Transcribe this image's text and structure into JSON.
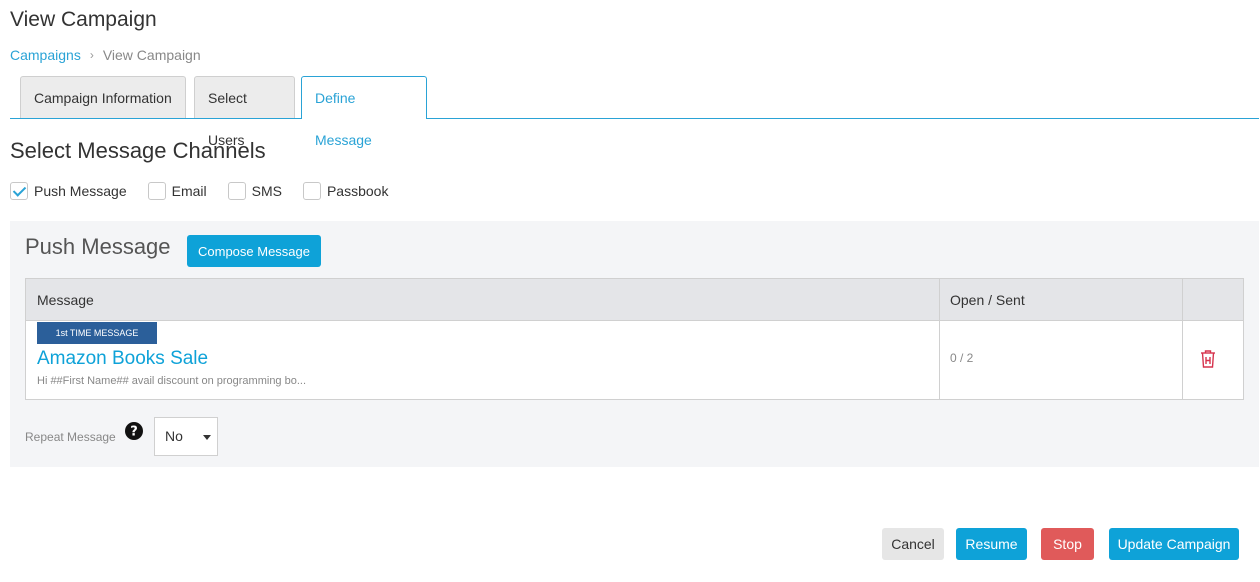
{
  "page": {
    "title": "View Campaign",
    "breadcrumb": [
      "Campaigns",
      "View Campaign"
    ]
  },
  "tabs": [
    {
      "label": "Campaign Information",
      "active": false
    },
    {
      "label": "Select Users",
      "active": false
    },
    {
      "label": "Define Message",
      "active": true
    }
  ],
  "channels": {
    "heading": "Select Message Channels",
    "items": [
      {
        "label": "Push Message",
        "checked": true
      },
      {
        "label": "Email",
        "checked": false
      },
      {
        "label": "SMS",
        "checked": false
      },
      {
        "label": "Passbook",
        "checked": false
      }
    ]
  },
  "push_panel": {
    "title": "Push Message",
    "compose_label": "Compose Message",
    "table": {
      "headers": [
        "Message",
        "Open / Sent"
      ],
      "rows": [
        {
          "badge": "1st TIME MESSAGE",
          "title": "Amazon Books Sale",
          "preview": "Hi ##First Name## avail discount on programming bo...",
          "open_sent": "0 / 2"
        }
      ]
    },
    "repeat": {
      "label": "Repeat Message",
      "value": "No"
    }
  },
  "actions": {
    "cancel": "Cancel",
    "resume": "Resume",
    "stop": "Stop",
    "update": "Update Campaign"
  },
  "colors": {
    "accent": "#0ea2d8",
    "badge": "#2b5f9a",
    "danger": "#e05a5a",
    "delete_icon": "#d6334d"
  },
  "icons": {
    "breadcrumb_separator": "chevron-right-icon",
    "help": "question-circle-icon",
    "delete": "trash-icon",
    "dropdown": "caret-down-icon"
  }
}
